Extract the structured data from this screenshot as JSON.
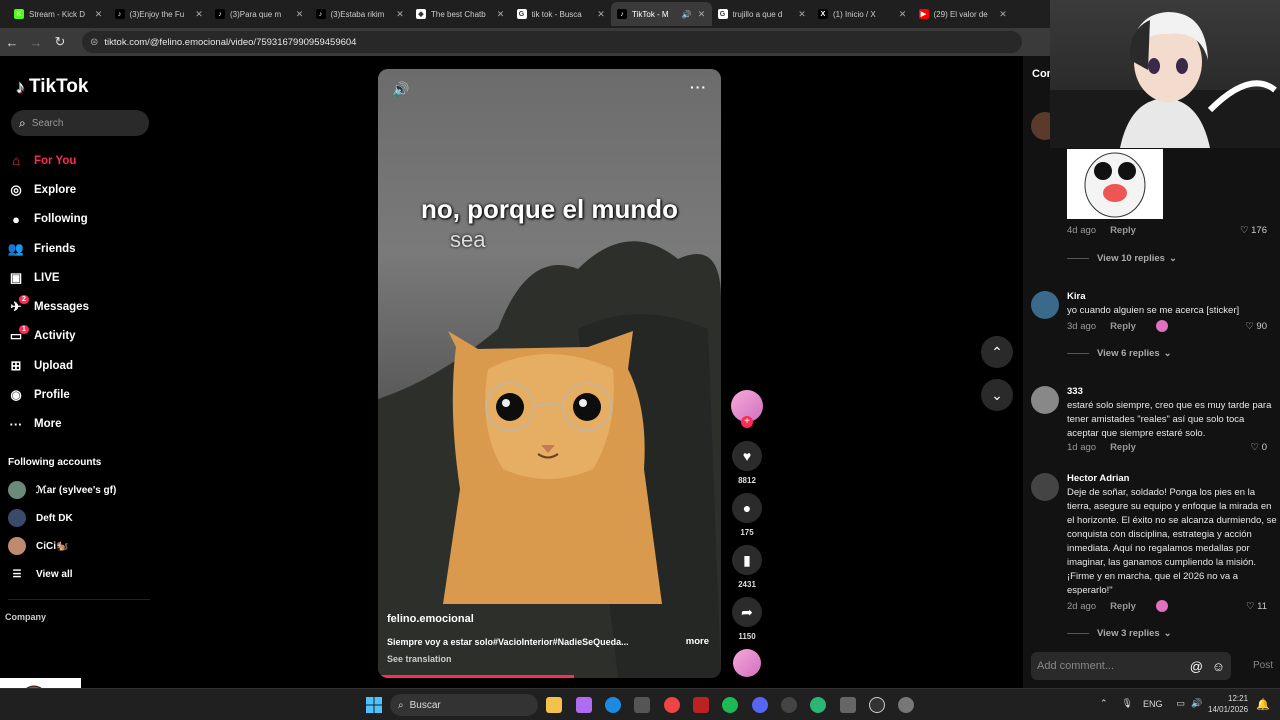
{
  "browser": {
    "tabs": [
      {
        "title": "Stream - Kick D",
        "color": "#53fc18",
        "glyph": "K"
      },
      {
        "title": "(3)Enjoy the Fu",
        "color": "#000000",
        "glyph": "♪"
      },
      {
        "title": "(3)Para que m",
        "color": "#000000",
        "glyph": "♪"
      },
      {
        "title": "(3)Estaba rikim",
        "color": "#000000",
        "glyph": "♪"
      },
      {
        "title": "The best Chatb",
        "color": "#ffffff",
        "glyph": "◆"
      },
      {
        "title": "tik tok - Busca",
        "color": "#ffffff",
        "glyph": "G"
      },
      {
        "title": "TikTok - M",
        "color": "#000000",
        "glyph": "♪",
        "active": true
      },
      {
        "title": "trujillo a que d",
        "color": "#ffffff",
        "glyph": "G"
      },
      {
        "title": "(1) Inicio / X",
        "color": "#000000",
        "glyph": "X"
      },
      {
        "title": "(29) El valor de",
        "color": "#ff0000",
        "glyph": "▶"
      }
    ],
    "url": "tiktok.com/@felino.emocional/video/7593167990959459604"
  },
  "sidebar": {
    "brand": "TikTok",
    "search_placeholder": "Search",
    "menu": [
      {
        "label": "For You",
        "icon": "home-icon",
        "glyph": "⌂",
        "active": true
      },
      {
        "label": "Explore",
        "icon": "compass-icon",
        "glyph": "◎"
      },
      {
        "label": "Following",
        "icon": "following-avatar-icon",
        "glyph": "●"
      },
      {
        "label": "Friends",
        "icon": "friends-icon",
        "glyph": "👥"
      },
      {
        "label": "LIVE",
        "icon": "live-icon",
        "glyph": "▣"
      },
      {
        "label": "Messages",
        "icon": "messages-icon",
        "glyph": "✈",
        "badge": "2"
      },
      {
        "label": "Activity",
        "icon": "activity-icon",
        "glyph": "▭",
        "badge": "1"
      },
      {
        "label": "Upload",
        "icon": "upload-icon",
        "glyph": "⊞"
      },
      {
        "label": "Profile",
        "icon": "profile-avatar-icon",
        "glyph": "◉"
      },
      {
        "label": "More",
        "icon": "more-icon",
        "glyph": "···"
      }
    ],
    "following_title": "Following accounts",
    "following": [
      {
        "name": "ℳar (sylvee's gf)",
        "color": "#6a8a7a"
      },
      {
        "name": "Deft DK",
        "color": "#3a4a6a"
      },
      {
        "name": "CiCi🐿️",
        "color": "#c08a70"
      }
    ],
    "view_all": "View all",
    "company": "Company"
  },
  "video": {
    "caption_line1": "no, porque el mundo",
    "caption_line2": "sea",
    "author": "felino.emocional",
    "description": "Siempre voy a estar solo#VacioInterior#NadieSeQueda...",
    "more": "more",
    "see_translation": "See translation",
    "progress": 0.57
  },
  "actions": {
    "likes": "8812",
    "comments": "175",
    "saves": "2431",
    "shares": "1150"
  },
  "comments": {
    "header": "Com",
    "items": [
      {
        "name": "",
        "text": "",
        "time": "4d ago",
        "reply": "Reply",
        "likes": "176",
        "view_replies": "View 10 replies",
        "avatar": "#5a3a2a"
      },
      {
        "name": "Kira",
        "text": "yo cuando alguien se me acerca [sticker]",
        "time": "3d ago",
        "reply": "Reply",
        "likes": "90",
        "view_replies": "View 6 replies",
        "avatar": "#3a6a8a"
      },
      {
        "name": "333",
        "text": "estaré solo siempre, creo que es muy tarde para tener amistades \"reales\" así que solo toca aceptar que siempre estaré solo.",
        "time": "1d ago",
        "reply": "Reply",
        "likes": "0",
        "avatar": "#888888"
      },
      {
        "name": "Hector Adrian",
        "text": "Deje de soñar, soldado! Ponga los pies en la tierra, asegure su equipo y enfoque la mirada en el horizonte. El éxito no se alcanza durmiendo, se conquista con disciplina, estrategia y acción inmediata. Aquí no regalamos medallas por imaginar, las ganamos cumpliendo la misión. ¡Firme y en marcha, que el 2026 no va a esperarlo!\"",
        "time": "2d ago",
        "reply": "Reply",
        "likes": "11",
        "view_replies": "View 3 replies",
        "avatar": "#444444"
      }
    ],
    "input_placeholder": "Add comment...",
    "post": "Post"
  },
  "taskbar": {
    "search_placeholder": "Buscar",
    "lang": "ENG",
    "time": "12:21",
    "date": "14/01/2026"
  },
  "colors": {
    "accent": "#fe2c55"
  }
}
